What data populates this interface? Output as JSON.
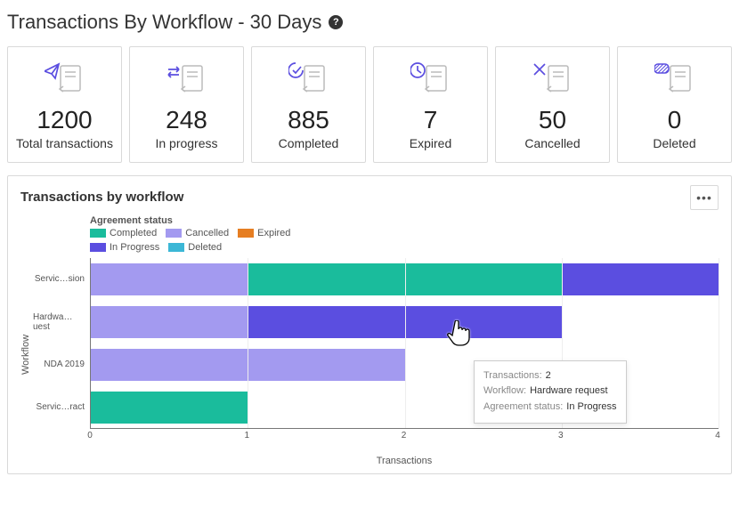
{
  "title": "Transactions By Workflow - 30 Days",
  "cards": [
    {
      "value": "1200",
      "label": "Total transactions"
    },
    {
      "value": "248",
      "label": "In progress"
    },
    {
      "value": "885",
      "label": "Completed"
    },
    {
      "value": "7",
      "label": "Expired"
    },
    {
      "value": "50",
      "label": "Cancelled"
    },
    {
      "value": "0",
      "label": "Deleted"
    }
  ],
  "panel": {
    "title": "Transactions by workflow",
    "more_glyph": "•••"
  },
  "legend": {
    "title": "Agreement status",
    "items": [
      {
        "label": "Completed",
        "color": "#1abc9c"
      },
      {
        "label": "Cancelled",
        "color": "#a39af0"
      },
      {
        "label": "Expired",
        "color": "#e67e22"
      },
      {
        "label": "In Progress",
        "color": "#5b4ee0"
      },
      {
        "label": "Deleted",
        "color": "#3cb7d6"
      }
    ]
  },
  "axes": {
    "y_label": "Workflow",
    "x_label": "Transactions",
    "x_ticks": [
      "0",
      "1",
      "2",
      "3",
      "4"
    ],
    "y_ticks": [
      "Servic…sion",
      "Hardwa…uest",
      "NDA 2019",
      "Servic…ract"
    ]
  },
  "tooltip": {
    "k1": "Transactions:",
    "v1": "2",
    "k2": "Workflow:",
    "v2": "Hardware request",
    "k3": "Agreement status:",
    "v3": "In Progress"
  },
  "colors": {
    "completed": "#1abc9c",
    "cancelled": "#a39af0",
    "expired": "#e67e22",
    "in_progress": "#5b4ee0",
    "deleted": "#3cb7d6"
  },
  "chart_data": {
    "type": "bar",
    "orientation": "horizontal",
    "stacked": true,
    "title": "Transactions by workflow",
    "xlabel": "Transactions",
    "ylabel": "Workflow",
    "xlim": [
      0,
      4
    ],
    "categories": [
      "Servic…sion",
      "Hardwa…uest",
      "NDA 2019",
      "Servic…ract"
    ],
    "series": [
      {
        "name": "Cancelled",
        "color": "#a39af0",
        "values": [
          1,
          1,
          2,
          0
        ]
      },
      {
        "name": "Completed",
        "color": "#1abc9c",
        "values": [
          2,
          0,
          0,
          1
        ]
      },
      {
        "name": "In Progress",
        "color": "#5b4ee0",
        "values": [
          1,
          2,
          0,
          0
        ]
      },
      {
        "name": "Expired",
        "color": "#e67e22",
        "values": [
          0,
          0,
          0,
          0
        ]
      },
      {
        "name": "Deleted",
        "color": "#3cb7d6",
        "values": [
          0,
          0,
          0,
          0
        ]
      }
    ],
    "legend_position": "top-left",
    "grid": true
  }
}
